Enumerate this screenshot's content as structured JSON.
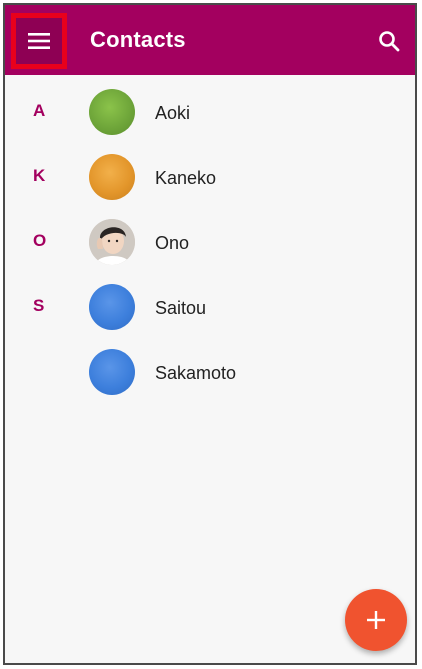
{
  "app_bar": {
    "title": "Contacts",
    "menu_icon": "menu-icon",
    "search_icon": "search-icon",
    "color": "#a3005f",
    "highlight_color": "#e8001c"
  },
  "contacts": [
    {
      "section": "A",
      "name": "Aoki",
      "avatar_color": "#6fa63a"
    },
    {
      "section": "K",
      "name": "Kaneko",
      "avatar_color": "#e3962b"
    },
    {
      "section": "O",
      "name": "Ono",
      "avatar_color": "photo"
    },
    {
      "section": "S",
      "name": "Saitou",
      "avatar_color": "#3d7fdc"
    },
    {
      "section": "",
      "name": "Sakamoto",
      "avatar_color": "#3d7fdc"
    }
  ],
  "fab": {
    "icon": "plus-icon",
    "color": "#f0532f"
  }
}
